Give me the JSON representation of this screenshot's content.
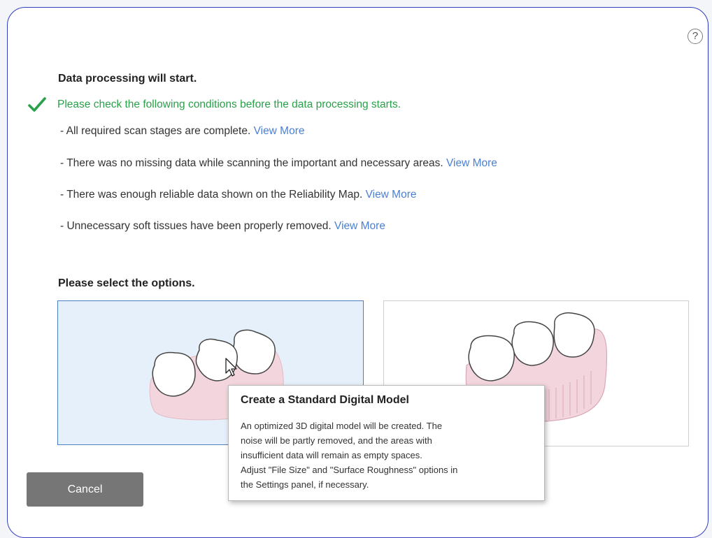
{
  "dialog": {
    "title": "Data processing will start.",
    "check_message": "Please check the following conditions before the data processing starts.",
    "conditions": [
      {
        "text": "- All required scan stages are complete.",
        "link": "View More"
      },
      {
        "text": "- There was no missing data while scanning the important and necessary areas.",
        "link": "View More"
      },
      {
        "text": "- There was enough reliable data shown on the Reliability Map.",
        "link": "View More"
      },
      {
        "text": "- Unnecessary soft tissues have been properly removed.",
        "link": "View More"
      }
    ],
    "help_label": "?",
    "options_heading": "Please select the options.",
    "cancel_label": "Cancel"
  },
  "tooltip": {
    "title": "Create a Standard Digital Model",
    "lines": [
      "An optimized 3D digital model will be created. The",
      "noise will be partly removed, and the areas with",
      "insufficient data will remain as empty spaces.",
      "Adjust \"File Size\" and \"Surface Roughness\" options in",
      "the Settings panel, if necessary."
    ]
  },
  "colors": {
    "accent_border": "#2f3dbf",
    "check_green": "#2aa04a",
    "link_blue": "#4a7fd6",
    "selected_card_bg": "#e6f0fa",
    "gum_pink": "#f3d6dd",
    "cancel_bg": "#767676"
  }
}
